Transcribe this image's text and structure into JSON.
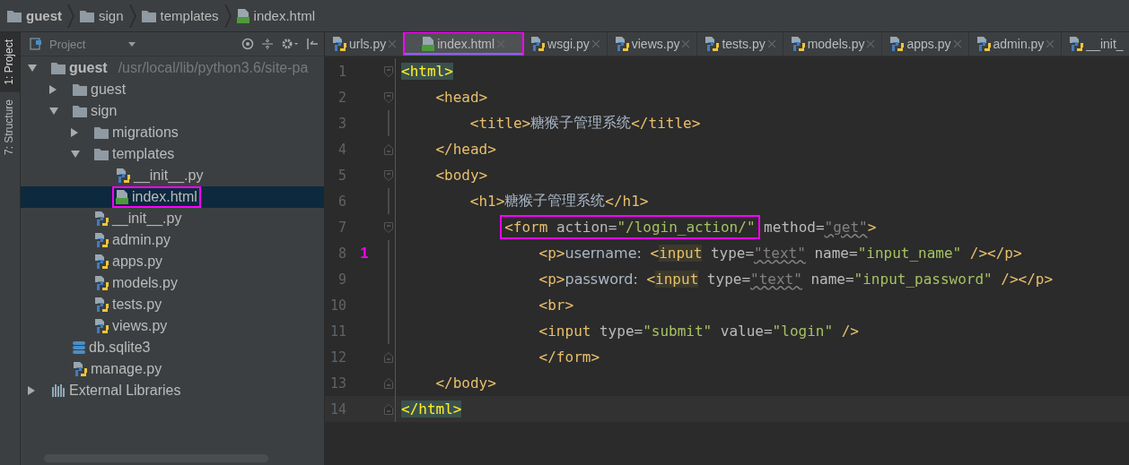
{
  "breadcrumb": [
    {
      "label": "guest",
      "kind": "folder"
    },
    {
      "label": "sign",
      "kind": "folder"
    },
    {
      "label": "templates",
      "kind": "folder"
    },
    {
      "label": "index.html",
      "kind": "html"
    }
  ],
  "tool_strip": [
    {
      "label": "1: Project",
      "selected": true
    },
    {
      "label": "7: Structure",
      "selected": false
    }
  ],
  "project_panel": {
    "title": "Project",
    "tree": [
      {
        "label": "guest",
        "path": "/usr/local/lib/python3.6/site-pa",
        "kind": "folder",
        "expanded": true,
        "selected": false,
        "highlighted": false,
        "children": [
          {
            "label": "guest",
            "kind": "folder",
            "expanded": false,
            "selected": false,
            "highlighted": false
          },
          {
            "label": "sign",
            "kind": "folder",
            "expanded": true,
            "selected": false,
            "highlighted": false,
            "children": [
              {
                "label": "migrations",
                "kind": "folder",
                "expanded": false,
                "selected": false,
                "highlighted": false
              },
              {
                "label": "templates",
                "kind": "folder",
                "expanded": true,
                "selected": false,
                "highlighted": false,
                "children": [
                  {
                    "label": "__init__.py",
                    "kind": "py",
                    "selected": false,
                    "highlighted": false
                  },
                  {
                    "label": "index.html",
                    "kind": "html",
                    "selected": true,
                    "highlighted": true
                  }
                ]
              },
              {
                "label": "__init__.py",
                "kind": "py",
                "selected": false,
                "highlighted": false
              },
              {
                "label": "admin.py",
                "kind": "py",
                "selected": false,
                "highlighted": false
              },
              {
                "label": "apps.py",
                "kind": "py",
                "selected": false,
                "highlighted": false
              },
              {
                "label": "models.py",
                "kind": "py",
                "selected": false,
                "highlighted": false
              },
              {
                "label": "tests.py",
                "kind": "py",
                "selected": false,
                "highlighted": false
              },
              {
                "label": "views.py",
                "kind": "py",
                "selected": false,
                "highlighted": false
              }
            ]
          },
          {
            "label": "db.sqlite3",
            "kind": "db",
            "selected": false,
            "highlighted": false
          },
          {
            "label": "manage.py",
            "kind": "py",
            "selected": false,
            "highlighted": false
          }
        ]
      },
      {
        "label": "External Libraries",
        "kind": "lib",
        "expanded": false,
        "selected": false,
        "highlighted": false
      }
    ]
  },
  "tabs": [
    {
      "label": "urls.py",
      "kind": "py",
      "selected": false,
      "highlighted": false,
      "closable": true
    },
    {
      "label": "index.html",
      "kind": "html",
      "selected": true,
      "highlighted": true,
      "closable": true
    },
    {
      "label": "wsgi.py",
      "kind": "py",
      "selected": false,
      "highlighted": false,
      "closable": true
    },
    {
      "label": "views.py",
      "kind": "py",
      "selected": false,
      "highlighted": false,
      "closable": true
    },
    {
      "label": "tests.py",
      "kind": "py",
      "selected": false,
      "highlighted": false,
      "closable": true
    },
    {
      "label": "models.py",
      "kind": "py",
      "selected": false,
      "highlighted": false,
      "closable": true
    },
    {
      "label": "apps.py",
      "kind": "py",
      "selected": false,
      "highlighted": false,
      "closable": true
    },
    {
      "label": "admin.py",
      "kind": "py",
      "selected": false,
      "highlighted": false,
      "closable": true
    },
    {
      "label": "__init_",
      "kind": "py",
      "selected": false,
      "highlighted": false,
      "closable": false
    }
  ],
  "code": [
    {
      "number": "1",
      "kind": "fold-start",
      "tokens": [
        {
          "kind": "tag-match",
          "text": "<html>"
        }
      ],
      "children": [
        {
          "number": "2",
          "kind": "fold-start",
          "tokens": [
            {
              "kind": "tag",
              "text": "<head>"
            }
          ],
          "children": [
            {
              "number": "3",
              "kind": "plain",
              "tokens": [
                {
                  "kind": "tag",
                  "text": "<title>"
                },
                {
                  "kind": "text",
                  "text": "糖猴子管理系统"
                },
                {
                  "kind": "tag",
                  "text": "</title>"
                }
              ]
            }
          ]
        },
        {
          "number": "4",
          "kind": "fold-end",
          "tokens": [
            {
              "kind": "tag",
              "text": "</head>"
            }
          ]
        },
        {
          "number": "5",
          "kind": "fold-start",
          "tokens": [
            {
              "kind": "tag",
              "text": "<body>"
            }
          ],
          "children": [
            {
              "number": "6",
              "kind": "plain",
              "tokens": [
                {
                  "kind": "tag",
                  "text": "<h1>"
                },
                {
                  "kind": "text",
                  "text": "糖猴子管理系统"
                },
                {
                  "kind": "tag",
                  "text": "</h1>"
                }
              ],
              "children": [
                {
                  "number": "7",
                  "kind": "fold-start",
                  "tokens": [
                    {
                      "kind": "tag",
                      "text": "<form",
                      "boxed": true
                    },
                    {
                      "kind": "attr",
                      "text": "action=",
                      "boxed": true
                    },
                    {
                      "kind": "str",
                      "text": "\"/login_action/\"",
                      "boxed": true
                    },
                    {
                      "kind": "attr",
                      "text": "method="
                    },
                    {
                      "kind": "warn",
                      "text": "\"get\""
                    },
                    {
                      "kind": "tag",
                      "text": ">"
                    }
                  ],
                  "children": [
                    {
                      "number": "8",
                      "marker": "1",
                      "kind": "plain",
                      "tokens": [
                        {
                          "kind": "tag",
                          "text": "<p>"
                        },
                        {
                          "kind": "text",
                          "text": "username:"
                        },
                        {
                          "kind": "tag",
                          "text": "<"
                        },
                        {
                          "kind": "tag-hl",
                          "text": "input"
                        },
                        {
                          "kind": "attr",
                          "text": "type="
                        },
                        {
                          "kind": "warn",
                          "text": "\"text\""
                        },
                        {
                          "kind": "attr",
                          "text": "name="
                        },
                        {
                          "kind": "str",
                          "text": "\"input_name\""
                        },
                        {
                          "kind": "tag",
                          "text": "/></p>"
                        }
                      ]
                    },
                    {
                      "number": "9",
                      "kind": "plain",
                      "tokens": [
                        {
                          "kind": "tag",
                          "text": "<p>"
                        },
                        {
                          "kind": "text",
                          "text": "password:"
                        },
                        {
                          "kind": "tag",
                          "text": "<"
                        },
                        {
                          "kind": "tag-hl",
                          "text": "input"
                        },
                        {
                          "kind": "attr",
                          "text": "type="
                        },
                        {
                          "kind": "warn",
                          "text": "\"text\""
                        },
                        {
                          "kind": "attr",
                          "text": "name="
                        },
                        {
                          "kind": "str",
                          "text": "\"input_password\""
                        },
                        {
                          "kind": "tag",
                          "text": "/></p>"
                        }
                      ]
                    },
                    {
                      "number": "10",
                      "kind": "plain",
                      "tokens": [
                        {
                          "kind": "tag",
                          "text": "<br>"
                        }
                      ]
                    },
                    {
                      "number": "11",
                      "kind": "plain",
                      "tokens": [
                        {
                          "kind": "tag",
                          "text": "<input"
                        },
                        {
                          "kind": "attr",
                          "text": "type="
                        },
                        {
                          "kind": "str",
                          "text": "\"submit\""
                        },
                        {
                          "kind": "attr",
                          "text": "value="
                        },
                        {
                          "kind": "str",
                          "text": "\"login\""
                        },
                        {
                          "kind": "tag",
                          "text": "/>"
                        }
                      ]
                    },
                    {
                      "number": "12",
                      "kind": "fold-end",
                      "tokens": [
                        {
                          "kind": "tag",
                          "text": "</form>"
                        }
                      ]
                    }
                  ]
                }
              ]
            }
          ]
        },
        {
          "number": "13",
          "kind": "fold-end",
          "tokens": [
            {
              "kind": "tag",
              "text": "</body>"
            }
          ]
        }
      ]
    },
    {
      "number": "14",
      "kind": "fold-end",
      "tokens": [
        {
          "kind": "tag-match",
          "text": "</html>"
        }
      ]
    }
  ]
}
